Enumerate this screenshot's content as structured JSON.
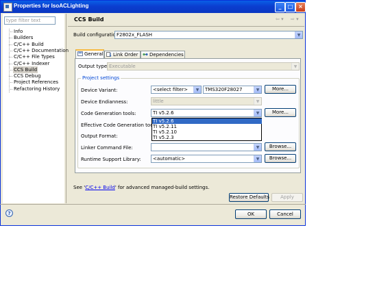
{
  "window": {
    "title": "Properties for IsoACLighting"
  },
  "titlebar": {
    "minimize": "_",
    "maximize": "□",
    "close": "×"
  },
  "sidebar": {
    "filter_placeholder": "type filter text",
    "items": [
      {
        "label": "Info"
      },
      {
        "label": "Builders"
      },
      {
        "label": "C/C++ Build"
      },
      {
        "label": "C/C++ Documentation"
      },
      {
        "label": "C/C++ File Types"
      },
      {
        "label": "C/C++ Indexer"
      },
      {
        "label": "CCS Build",
        "selected": true
      },
      {
        "label": "CCS Debug"
      },
      {
        "label": "Project References"
      },
      {
        "label": "Refactoring History"
      }
    ]
  },
  "page": {
    "title": "CCS Build"
  },
  "build_config": {
    "label": "Build configuration:",
    "value": "F2802x_FLASH"
  },
  "tabs": [
    {
      "label": "General",
      "icon": "general-tab-icon",
      "active": true
    },
    {
      "label": "Link Order",
      "icon": "link-order-icon"
    },
    {
      "label": "Dependencies",
      "icon": "dependencies-icon"
    }
  ],
  "output_type": {
    "label": "Output type:",
    "value": "Executable"
  },
  "project_settings": {
    "group_label": "Project settings",
    "device_variant": {
      "label": "Device Variant:",
      "filter": "<select filter>",
      "value": "TMS320F28027",
      "more": "More..."
    },
    "device_endianness": {
      "label": "Device Endianness:",
      "value": "little"
    },
    "code_gen_tools": {
      "label": "Code Generation tools:",
      "value": "TI v5.2.6",
      "more": "More..."
    },
    "effective_cgt": {
      "label": "Effective Code Generation tools:"
    },
    "output_format": {
      "label": "Output Format:"
    },
    "linker_cmd": {
      "label": "Linker Command File:",
      "value": "",
      "browse": "Browse..."
    },
    "runtime_lib": {
      "label": "Runtime Support Library:",
      "value": "<automatic>",
      "browse": "Browse..."
    }
  },
  "dropdown": {
    "options": [
      "TI v5.2.6",
      "TI v5.2.11",
      "TI v5.2.10",
      "TI v5.2.3"
    ],
    "selected_index": 0
  },
  "footer": {
    "see_prefix": "See '",
    "see_link": "C/C++ Build",
    "see_suffix": "' for advanced managed-build settings.",
    "restore": "Restore Defaults",
    "apply": "Apply",
    "ok": "OK",
    "cancel": "Cancel",
    "help": "?"
  },
  "colors": {
    "titlebar": "#0a5fe6",
    "selection": "#316ac5",
    "link": "#0000ee"
  }
}
